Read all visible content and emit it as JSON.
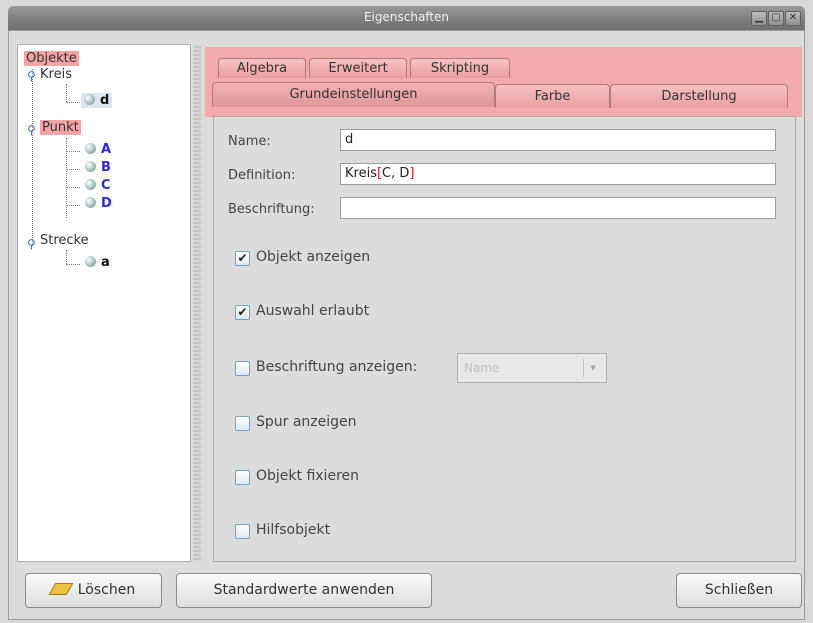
{
  "window": {
    "title": "Eigenschaften",
    "buttons": {
      "minimize": "▁",
      "maximize": "□",
      "close": "✕"
    }
  },
  "tree": {
    "root": "Objekte",
    "groups": [
      {
        "label": "Kreis",
        "items": [
          "d"
        ]
      },
      {
        "label": "Punkt",
        "items": [
          "A",
          "B",
          "C",
          "D"
        ]
      },
      {
        "label": "Strecke",
        "items": [
          "a"
        ]
      }
    ]
  },
  "tabs": {
    "row_back": [
      "Algebra",
      "Erweitert",
      "Skripting"
    ],
    "row_front": [
      "Grundeinstellungen",
      "Farbe",
      "Darstellung"
    ],
    "selected": "Grundeinstellungen"
  },
  "form": {
    "name_label": "Name:",
    "name_value": "d",
    "definition_label": "Definition:",
    "definition_prefix": "Kreis",
    "definition_bracket_open": "[",
    "definition_args": "C, D",
    "definition_bracket_close": "]",
    "caption_label": "Beschriftung:",
    "caption_value": ""
  },
  "checkboxes": [
    {
      "label": "Objekt anzeigen",
      "checked": true
    },
    {
      "label": "Auswahl erlaubt",
      "checked": true
    },
    {
      "label": "Beschriftung anzeigen:",
      "checked": false
    },
    {
      "label": "Spur anzeigen",
      "checked": false
    },
    {
      "label": "Objekt fixieren",
      "checked": false
    },
    {
      "label": "Hilfsobjekt",
      "checked": false
    }
  ],
  "label_mode_select": {
    "value": "Name",
    "enabled": false
  },
  "footer": {
    "delete": "Löschen",
    "apply_defaults": "Standardwerte anwenden",
    "close": "Schließen"
  },
  "colors": {
    "highlight": "#f4a4a4",
    "point_label": "#2b2bd6"
  }
}
